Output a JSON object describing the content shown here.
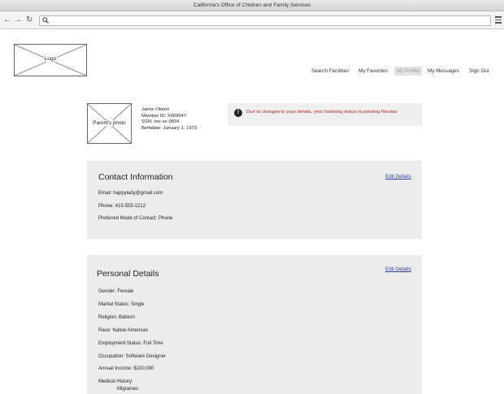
{
  "browser": {
    "window_title": "California's Office of Children and Family Services",
    "back_glyph": "←",
    "forward_glyph": "→",
    "reload_glyph": "↻"
  },
  "header": {
    "logo_label": "Logo",
    "nav": [
      "Search Facilities",
      "My Favorites",
      "My Profile",
      "My Messages",
      "Sign Out"
    ],
    "active_nav": "My Profile"
  },
  "profile": {
    "photo_label": "Parent's photo",
    "name": "Jaime Oberin",
    "member_id": "Member ID: X009547",
    "ssn": "SSN: xxx-xx-9834",
    "birthdate": "Birthdate: January 1, 1979"
  },
  "alert": {
    "icon": "!",
    "message": "Due to changes to your details, your fostering status is pending Review"
  },
  "contact": {
    "title": "Contact Information",
    "edit_label": "Edit Details",
    "fields": [
      "Email:  happylady@gmail.com",
      "Phone:  415-555-1212",
      "Preferred Mode of Contact:  Phone"
    ]
  },
  "personal": {
    "title": "Personal Details",
    "edit_label": "Edit Details",
    "fields": [
      "Gender:  Female",
      "Marital Status:  Single",
      "Religion:  Bábism",
      "Race:  Native American",
      "Employment Status:  Full Time",
      "Occupation:  Software Designer",
      "Annual Income:  $100,000",
      "Medical History:"
    ],
    "medical_history": [
      "Migraines"
    ]
  }
}
